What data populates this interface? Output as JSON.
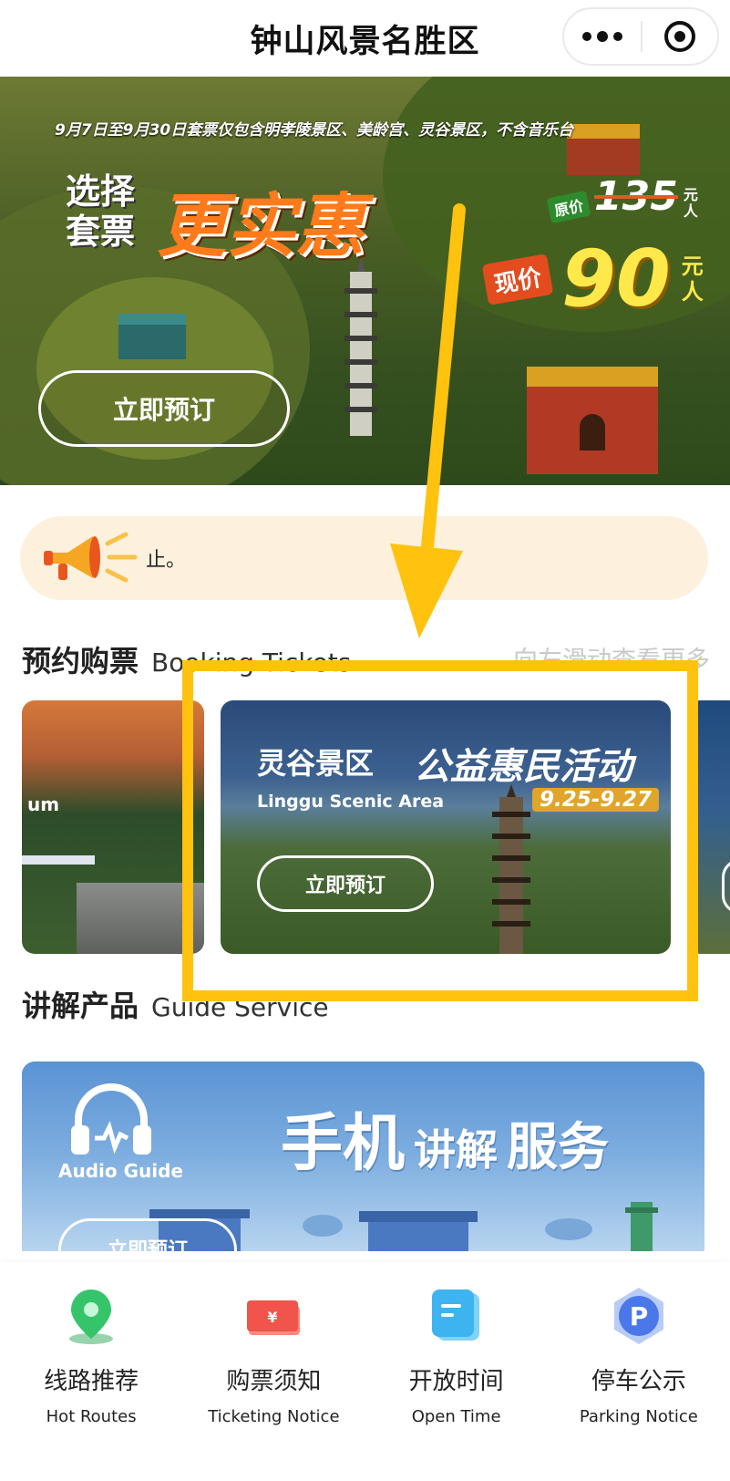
{
  "header": {
    "title": "钟山风景名胜区"
  },
  "banner": {
    "notice": "9月7日至9月30日套票仅包含明孝陵景区、美龄宫、灵谷景区，不含音乐台",
    "choose_line1": "选择",
    "choose_line2": "套票",
    "value_text": "更实惠",
    "orig_tag": "原价",
    "orig_price": "135",
    "orig_unit_line1": "元",
    "orig_unit_line2": "人",
    "now_tag": "现价",
    "now_price": "90",
    "now_unit_line1": "元",
    "now_unit_line2": "人",
    "book_label": "立即预订"
  },
  "notice_bar": {
    "text": "止。",
    "icon": "megaphone-icon"
  },
  "booking": {
    "title_cn": "预约购票",
    "title_en": "Booking Tickets",
    "hint": "向左滑动查看更多",
    "cards": [
      {
        "label": "um"
      },
      {
        "title_cn": "灵谷景区",
        "promo": "公益惠民活动",
        "title_en": "Linggu Scenic Area",
        "dates": "9.25-9.27",
        "button": "立即预订"
      },
      {
        "label": ""
      }
    ]
  },
  "guide": {
    "title_cn": "讲解产品",
    "title_en": "Guide Service",
    "audio_label": "Audio Guide",
    "slogan_a": "手机",
    "slogan_b": "讲解",
    "slogan_c": "服务",
    "button": "立即预订"
  },
  "tabbar": {
    "items": [
      {
        "cn": "线路推荐",
        "en": "Hot Routes",
        "icon": "map-pin-icon",
        "color": "#35c46a"
      },
      {
        "cn": "购票须知",
        "en": "Ticketing Notice",
        "icon": "ticket-icon",
        "color": "#f0544a"
      },
      {
        "cn": "开放时间",
        "en": "Open Time",
        "icon": "document-icon",
        "color": "#3db4f0"
      },
      {
        "cn": "停车公示",
        "en": "Parking Notice",
        "icon": "parking-icon",
        "color": "#4a78e8"
      }
    ]
  },
  "colors": {
    "highlight": "#ffc20e",
    "accent_orange": "#ff7a1a",
    "price_yellow": "#ffe84a",
    "notice_bg": "#fdf1dd"
  }
}
